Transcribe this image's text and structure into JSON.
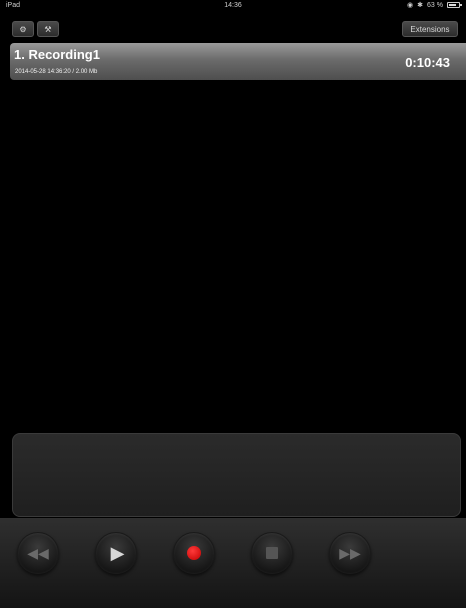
{
  "status_bar": {
    "device": "iPad",
    "time": "14:36",
    "battery": "63 %",
    "battery_level": 0.63
  },
  "toolbar": {
    "settings_icon": "settings-icon",
    "tools_icon": "tools-icon",
    "extensions_label": "Extensions"
  },
  "recordings": [
    {
      "title": "1. Recording1",
      "meta": "2014-05-28 14:36:20 / 2.00 Mb",
      "duration": "0:10:43"
    }
  ],
  "transport": {
    "rewind": "rewind-icon",
    "play": "play-icon",
    "record": "record-icon",
    "stop": "stop-icon",
    "fast_forward": "fast-forward-icon",
    "record_color": "#e00000"
  }
}
